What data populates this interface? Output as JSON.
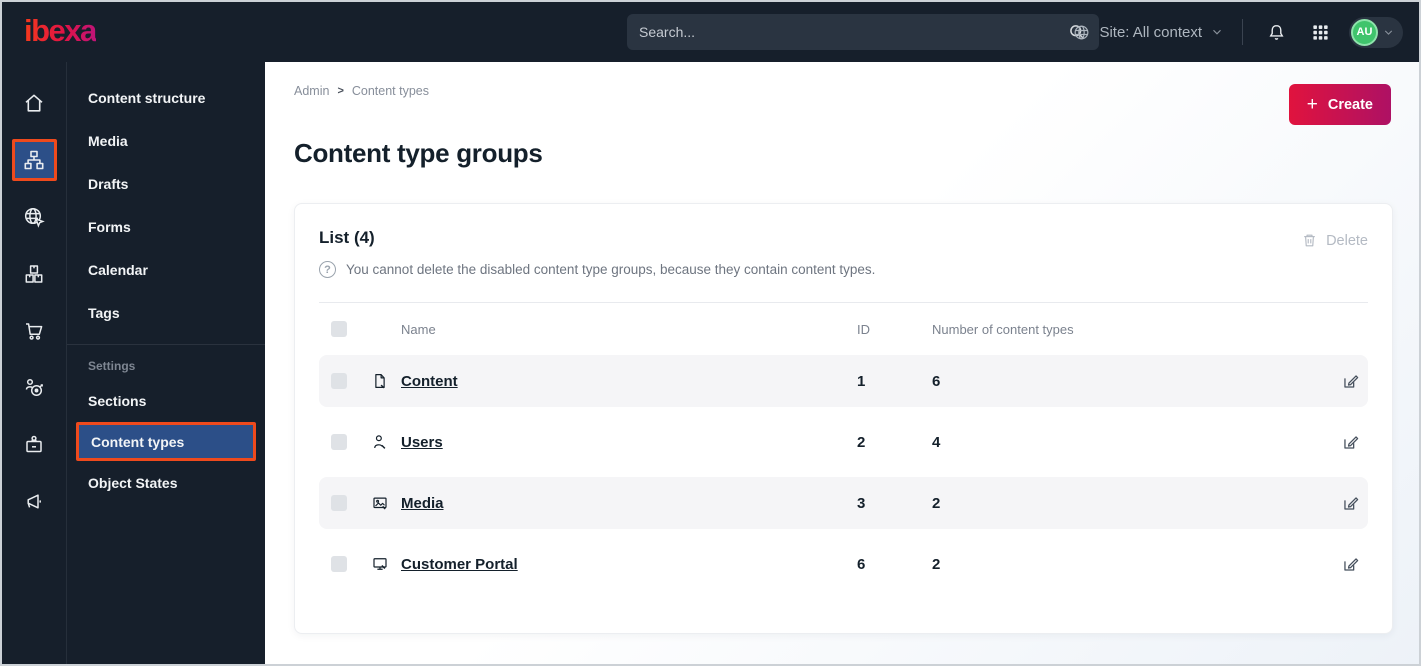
{
  "topbar": {
    "logo": "ibexa",
    "search_placeholder": "Search...",
    "site_context": "Site: All context",
    "avatar_initials": "AU",
    "icons": [
      "globe-icon",
      "chevron-down-icon",
      "bell-icon",
      "app-grid-icon"
    ]
  },
  "iconbar": {
    "items": [
      "home-icon",
      "sitemap-icon",
      "globe-pointer-icon",
      "boxes-icon",
      "cart-icon",
      "person-target-icon",
      "badge-icon",
      "megaphone-icon"
    ],
    "active_index": 1,
    "active_bg": "#2c4f88",
    "highlight_border": "#ee4a1d"
  },
  "sidebar": {
    "items": [
      {
        "label": "Content structure"
      },
      {
        "label": "Media"
      },
      {
        "label": "Drafts"
      },
      {
        "label": "Forms"
      },
      {
        "label": "Calendar"
      },
      {
        "label": "Tags"
      }
    ],
    "section_label": "Settings",
    "settings_items": [
      {
        "label": "Sections",
        "active": false
      },
      {
        "label": "Content types",
        "active": true
      },
      {
        "label": "Object States",
        "active": false
      }
    ]
  },
  "breadcrumb": {
    "items": [
      "Admin",
      "Content types"
    ],
    "separator": ">"
  },
  "header": {
    "title": "Content type groups",
    "create_label": "Create",
    "create_gradient": [
      "#e0133e",
      "#ae1164"
    ]
  },
  "list_card": {
    "title": "List (4)",
    "info": "You cannot delete the disabled content type groups, because they contain content types.",
    "delete_label": "Delete",
    "table": {
      "columns": [
        "Name",
        "ID",
        "Number of content types"
      ],
      "rows": [
        {
          "icon": "file-edit-icon",
          "name": "Content",
          "id": "1",
          "count": "6"
        },
        {
          "icon": "user-edit-icon",
          "name": "Users",
          "id": "2",
          "count": "4"
        },
        {
          "icon": "image-edit-icon",
          "name": "Media",
          "id": "3",
          "count": "2"
        },
        {
          "icon": "monitor-edit-icon",
          "name": "Customer Portal",
          "id": "6",
          "count": "2"
        }
      ]
    }
  },
  "colors": {
    "topbar_bg": "#161f2b",
    "active_blue": "#2c4f88",
    "highlight_orange": "#ee4a1d",
    "avatar_green": "#3fc46c",
    "text_dark": "#14202b",
    "row_stripe": "#f5f5f7"
  }
}
